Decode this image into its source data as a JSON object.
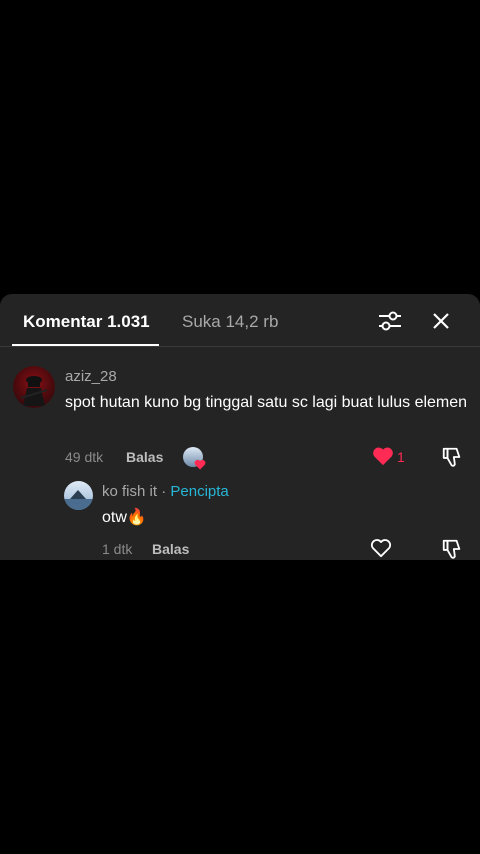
{
  "tabs": {
    "comments_label": "Komentar 1.031",
    "likes_label": "Suka 14,2 rb"
  },
  "comments": [
    {
      "username": "aziz_28",
      "text": "spot hutan kuno bg tinggal satu sc lagi buat lulus elemen",
      "time": "49 dtk",
      "reply_label": "Balas",
      "likes": "1",
      "liked": true
    }
  ],
  "reply": {
    "username": "ko fish it",
    "separator": " · ",
    "creator_badge": "Pencipta",
    "text": "otw",
    "emoji": "🔥",
    "time": "1 dtk",
    "reply_label": "Balas"
  },
  "colors": {
    "accent_like": "#ff2b55",
    "creator": "#27b6d6",
    "sheet_bg": "#242424"
  },
  "icons": [
    "filter-icon",
    "close-icon",
    "heart-icon",
    "dislike-icon"
  ]
}
